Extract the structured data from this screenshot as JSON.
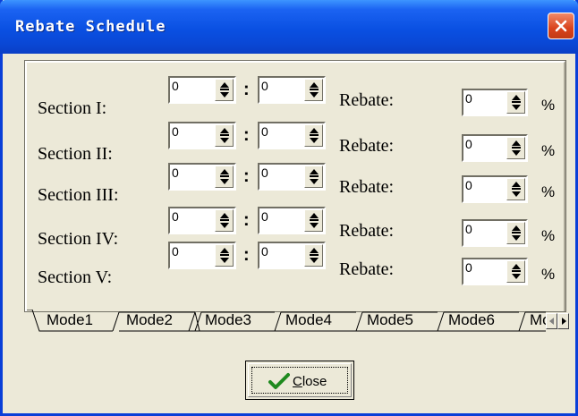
{
  "window": {
    "title": "Rebate Schedule"
  },
  "sections": [
    {
      "label": "Section I:",
      "from": "0",
      "to": "0",
      "rebate_label": "Rebate:",
      "rebate": "0",
      "unit": "%"
    },
    {
      "label": "Section II:",
      "from": "0",
      "to": "0",
      "rebate_label": "Rebate:",
      "rebate": "0",
      "unit": "%"
    },
    {
      "label": "Section III:",
      "from": "0",
      "to": "0",
      "rebate_label": "Rebate:",
      "rebate": "0",
      "unit": "%"
    },
    {
      "label": "Section IV:",
      "from": "0",
      "to": "0",
      "rebate_label": "Rebate:",
      "rebate": "0",
      "unit": "%"
    },
    {
      "label": "Section V:",
      "from": "0",
      "to": "0",
      "rebate_label": "Rebate:",
      "rebate": "0",
      "unit": "%"
    }
  ],
  "separator": ":",
  "tabs": [
    "Mode1",
    "Mode2",
    "Mode3",
    "Mode4",
    "Mode5",
    "Mode6",
    "Mode"
  ],
  "active_tab": "Mode1",
  "close_button": {
    "label_first": "C",
    "label_rest": "lose"
  }
}
